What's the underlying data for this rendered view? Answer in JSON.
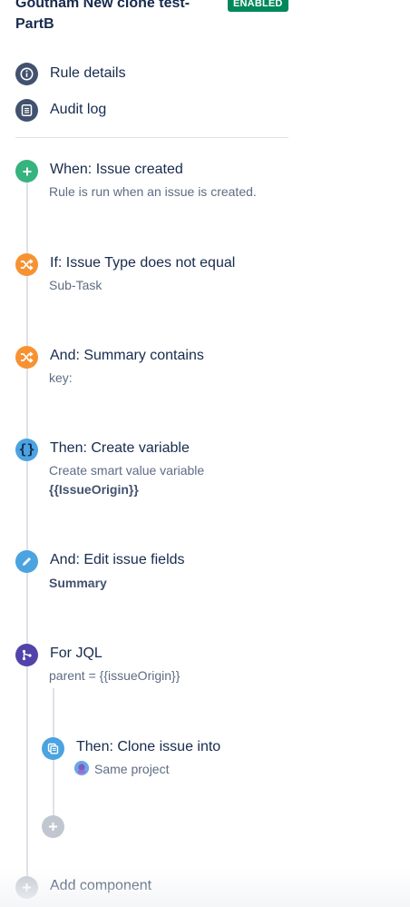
{
  "rule": {
    "title": "Goutham New clone test-PartB",
    "status": "ENABLED"
  },
  "nav": {
    "rule_details": "Rule details",
    "audit_log": "Audit log"
  },
  "components": [
    {
      "title": "When: Issue created",
      "description": "Rule is run when an issue is created.",
      "icon": "plus-icon",
      "color": "#36b37e"
    },
    {
      "title": "If: Issue Type does not equal",
      "description": "Sub-Task",
      "icon": "shuffle-icon",
      "color": "#f79233"
    },
    {
      "title": "And: Summary contains",
      "description": "key:",
      "icon": "shuffle-icon",
      "color": "#f79233"
    },
    {
      "title": "Then: Create variable",
      "description": "Create smart value variable",
      "detail": "{{IssueOrigin}}",
      "icon": "braces-icon",
      "color": "#4ba3e0"
    },
    {
      "title": "And: Edit issue fields",
      "detail": "Summary",
      "icon": "pencil-icon",
      "color": "#4ba3e0"
    },
    {
      "title": "For JQL",
      "description": "parent = {{issueOrigin}}",
      "icon": "branch-icon",
      "color": "#5243aa"
    },
    {
      "title": "Then: Clone issue into",
      "description": "Same project",
      "icon": "clone-icon",
      "color": "#4ba3e0"
    }
  ],
  "add_component_label": "Add component"
}
